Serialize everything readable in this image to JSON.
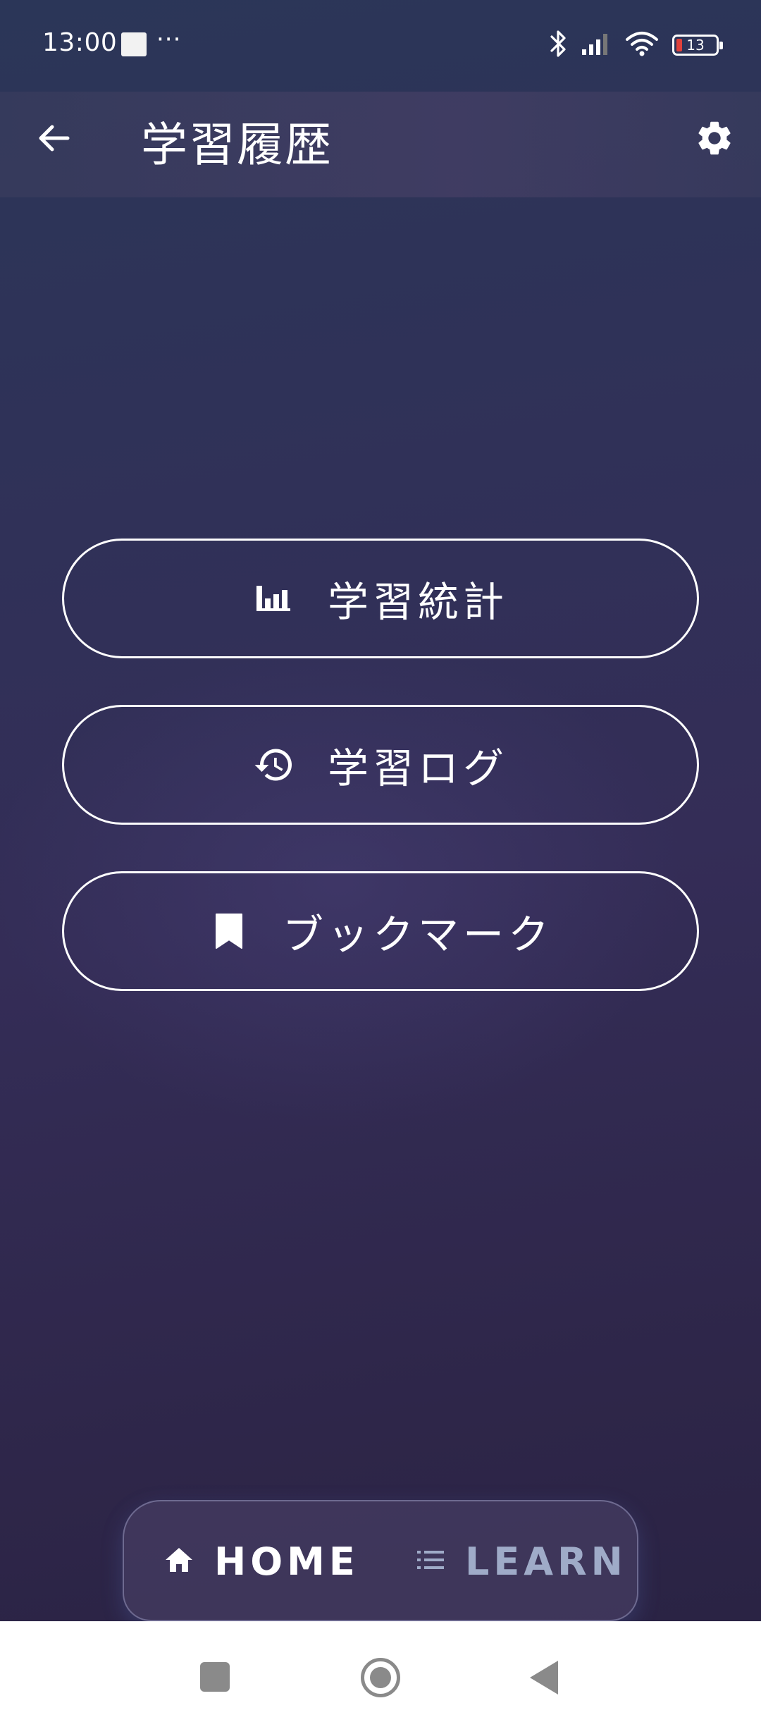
{
  "status_bar": {
    "time": "13:00",
    "extra": "···",
    "battery_level": "13",
    "battery_color": "#e0413b",
    "icons": [
      "screen-record-icon",
      "bluetooth-icon",
      "signal-icon",
      "wifi-icon",
      "battery-icon"
    ]
  },
  "app_bar": {
    "title": "学習履歴",
    "back_icon": "arrow-left-icon",
    "settings_icon": "gear-icon"
  },
  "menu": {
    "items": [
      {
        "label": "学習統計",
        "icon": "bar-chart-icon"
      },
      {
        "label": "学習ログ",
        "icon": "history-icon"
      },
      {
        "label": "ブックマーク",
        "icon": "bookmark-icon"
      }
    ]
  },
  "bottom_nav": {
    "items": [
      {
        "label": "HOME",
        "icon": "home-icon",
        "active": true
      },
      {
        "label": "LEARN",
        "icon": "list-icon",
        "active": false
      }
    ],
    "active_color": "#ffffff",
    "inactive_color": "#9fabc8"
  },
  "system_nav": {
    "buttons": [
      "recent-apps-button",
      "home-button",
      "back-button"
    ]
  }
}
